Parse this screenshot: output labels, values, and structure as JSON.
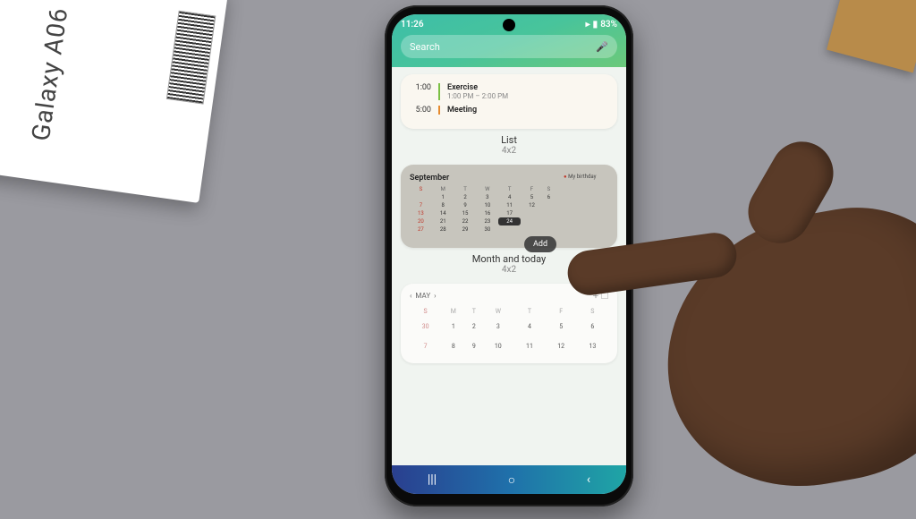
{
  "product_box": {
    "label": "Galaxy A06"
  },
  "status": {
    "time": "11:26",
    "battery": "83%"
  },
  "search": {
    "placeholder": "Search"
  },
  "list_widget": {
    "events": [
      {
        "time": "1:00",
        "title": "Exercise",
        "sub": "1:00 PM – 2:00 PM",
        "color": "green"
      },
      {
        "time": "5:00",
        "title": "Meeting",
        "sub": "",
        "color": "orange"
      }
    ],
    "label": "List",
    "size": "4x2"
  },
  "month_widget": {
    "month": "September",
    "dow": [
      "S",
      "M",
      "T",
      "W",
      "T",
      "F",
      "S"
    ],
    "weeks": [
      [
        "",
        "1",
        "2",
        "3",
        "4",
        "5",
        "6"
      ],
      [
        "7",
        "8",
        "9",
        "10",
        "11",
        "12",
        ""
      ],
      [
        "13",
        "14",
        "15",
        "16",
        "17",
        "",
        ""
      ],
      [
        "20",
        "21",
        "22",
        "23",
        "24",
        "",
        ""
      ],
      [
        "27",
        "28",
        "29",
        "30",
        "",
        "",
        ""
      ]
    ],
    "today": "24",
    "side_event": "My birthday",
    "label": "Month and today",
    "size": "4x2",
    "add_label": "Add"
  },
  "gcal_widget": {
    "month": "MAY",
    "dow": [
      "S",
      "M",
      "T",
      "W",
      "T",
      "F",
      "S"
    ],
    "weeks": [
      [
        "30",
        "1",
        "2",
        "3",
        "4",
        "5",
        "6"
      ],
      [
        "7",
        "8",
        "9",
        "10",
        "11",
        "12",
        "13"
      ]
    ]
  },
  "nav": {
    "recents": "|||",
    "home": "○",
    "back": "‹"
  }
}
